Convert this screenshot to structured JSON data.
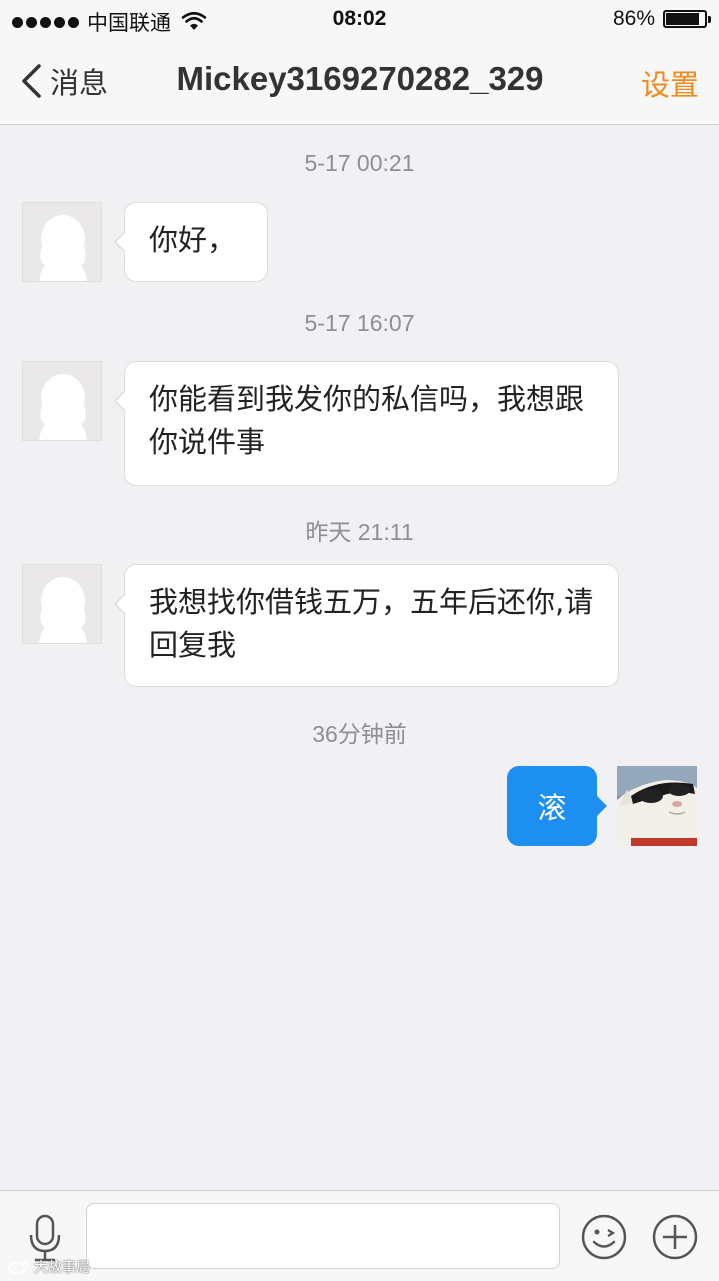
{
  "status_bar": {
    "carrier": "中国联通",
    "time": "08:02",
    "battery": "86%",
    "battery_level": 0.86,
    "icons": [
      "signal-dots",
      "wifi-icon",
      "battery-icon"
    ]
  },
  "nav": {
    "back_label": "消息",
    "title": "Mickey3169270282_329",
    "settings_label": "设置",
    "accent_color": "#f08a1c"
  },
  "messages": [
    {
      "timestamp": "5-17 00:21",
      "direction": "in",
      "text": "你好，"
    },
    {
      "timestamp": "5-17 16:07",
      "direction": "in",
      "text": "你能看到我发你的私信吗，我想跟你说件事"
    },
    {
      "timestamp": "昨天 21:11",
      "direction": "in",
      "text": "我想找你借钱五万，五年后还你,请回复我"
    },
    {
      "timestamp": "36分钟前",
      "direction": "out",
      "text": "滚"
    }
  ],
  "outgoing_bubble_color": "#1d8ff0",
  "input_bar": {
    "placeholder": "",
    "icons": [
      "microphone-icon",
      "emoji-icon",
      "plus-icon"
    ]
  },
  "watermark": "大故事局"
}
